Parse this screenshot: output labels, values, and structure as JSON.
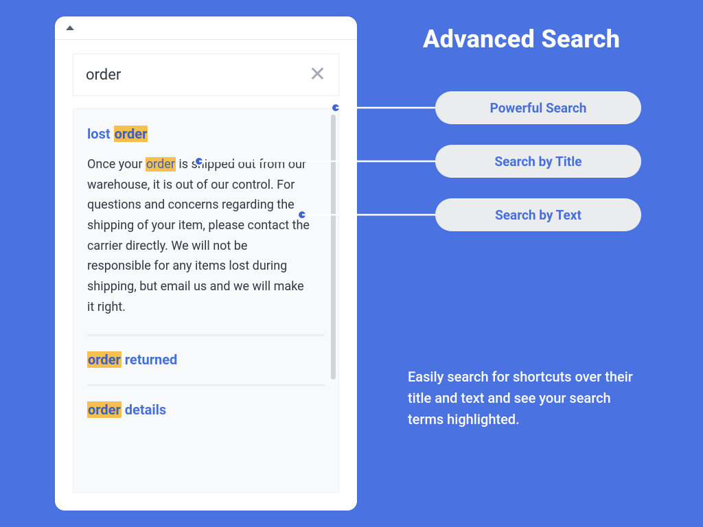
{
  "headline": "Advanced Search",
  "search": {
    "query": "order"
  },
  "results": {
    "hit1": {
      "title_pre": "lost ",
      "title_hl": "order",
      "title_post": "",
      "body_pre": "Once your ",
      "body_hl": "order",
      "body_post": " is shipped out from our warehouse, it is out of our control. For questions and concerns regarding the shipping of your item, please contact the carrier directly. We will not be responsible for any items lost during shipping, but email us and we will make it right."
    },
    "hit2": {
      "title_hl": "order",
      "title_post": " returned"
    },
    "hit3": {
      "title_hl": "order",
      "title_post": " details"
    }
  },
  "pills": {
    "p1": "Powerful Search",
    "p2": "Search by Title",
    "p3": "Search by Text"
  },
  "description": "Easily search for shortcuts over their title and text and see your search terms highlighted."
}
